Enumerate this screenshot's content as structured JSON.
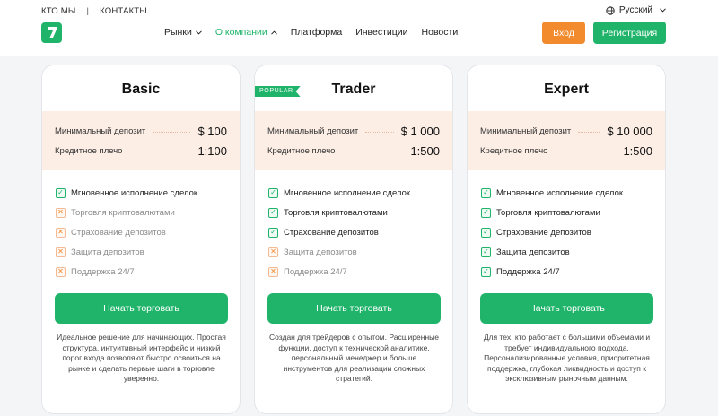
{
  "header": {
    "top_links": [
      "КТО МЫ",
      "КОНТАКТЫ"
    ],
    "separator": "|",
    "language": "Русский",
    "nav": [
      {
        "label": "Рынки",
        "caret": "▼"
      },
      {
        "label": "О компании",
        "caret": "▲"
      },
      {
        "label": "Платформа"
      },
      {
        "label": "Инвестиции"
      },
      {
        "label": "Новости"
      }
    ],
    "login_label": "Вход",
    "register_label": "Регистрация"
  },
  "labels": {
    "min_deposit": "Минимальный депозит",
    "leverage": "Кредитное плечо"
  },
  "plans": [
    {
      "name": "Basic",
      "min_deposit": "$ 100",
      "leverage": "1:100",
      "features": [
        {
          "label": "Мгновенное исполнение сделок",
          "included": true
        },
        {
          "label": "Торговля криптовалютами",
          "included": false
        },
        {
          "label": "Страхование депозитов",
          "included": false
        },
        {
          "label": "Защита депозитов",
          "included": false
        },
        {
          "label": "Поддержка 24/7",
          "included": false
        }
      ],
      "cta": "Начать торговать",
      "description": "Идеальное решение для начинающих. Простая структура, интуитивный интерфейс и низкий порог входа позволяют быстро освоиться на рынке и сделать первые шаги в торговле уверенно."
    },
    {
      "name": "Trader",
      "badge": "POPULAR",
      "min_deposit": "$ 1 000",
      "leverage": "1:500",
      "features": [
        {
          "label": "Мгновенное исполнение сделок",
          "included": true
        },
        {
          "label": "Торговля криптовалютами",
          "included": true
        },
        {
          "label": "Страхование депозитов",
          "included": true
        },
        {
          "label": "Защита депозитов",
          "included": false
        },
        {
          "label": "Поддержка 24/7",
          "included": false
        }
      ],
      "cta": "Начать торговать",
      "description": "Создан для трейдеров с опытом. Расширенные функции, доступ к технической аналитике, персональный менеджер и больше инструментов для реализации сложных стратегий."
    },
    {
      "name": "Expert",
      "min_deposit": "$ 10 000",
      "leverage": "1:500",
      "features": [
        {
          "label": "Мгновенное исполнение сделок",
          "included": true
        },
        {
          "label": "Торговля криптовалютами",
          "included": true
        },
        {
          "label": "Страхование депозитов",
          "included": true
        },
        {
          "label": "Защита депозитов",
          "included": true
        },
        {
          "label": "Поддержка 24/7",
          "included": true
        }
      ],
      "cta": "Начать торговать",
      "description": "Для тех, кто работает с большими объемами и требует индивидуального подхода. Персонализированные условия, приоритетная поддержка, глубокая ликвидность и доступ к эксклюзивным рыночным данным."
    }
  ],
  "icons": {
    "check": "check-icon",
    "cross": "cross-icon",
    "globe": "globe-icon",
    "logo": "logo-icon"
  },
  "colors": {
    "brand_green": "#1fb46a",
    "accent_orange": "#f28a2e",
    "terms_bg": "#fceee5"
  }
}
